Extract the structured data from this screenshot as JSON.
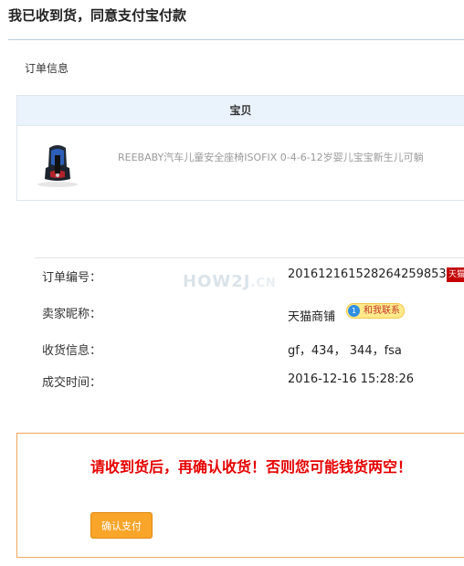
{
  "page": {
    "title": "我已收到货，同意支付宝付款"
  },
  "order_section": {
    "label": "订单信息"
  },
  "item_table": {
    "column_header": "宝贝",
    "item": {
      "name": "REEBABY汽车儿童安全座椅ISOFIX 0-4-6-12岁婴儿宝宝新生儿可躺",
      "image_icon": "car-seat-thumbnail"
    }
  },
  "order_info": {
    "order_number": {
      "label": "订单编号：",
      "value": "201612161528264259853"
    },
    "seller": {
      "label": "卖家昵称：",
      "value": "天猫商铺",
      "contact_badge": "和我联系",
      "badge_dot": "1"
    },
    "shipping": {
      "label": "收货信息：",
      "value": "gf，434， 344，fsa"
    },
    "deal_time": {
      "label": "成交时间：",
      "value": "2016-12-16 15:28:26"
    },
    "tmall_mark": "天猫"
  },
  "watermark": {
    "text": "HOW2J",
    "suffix": ".CN"
  },
  "notice": {
    "warning": "请收到货后，再确认收货！否则您可能钱货两空！",
    "confirm_button": "确认支付"
  },
  "colors": {
    "warning": "#e60000",
    "button": "#f8a52a",
    "header_bg": "#eaf2fb",
    "notice_border": "#f0a55a"
  }
}
